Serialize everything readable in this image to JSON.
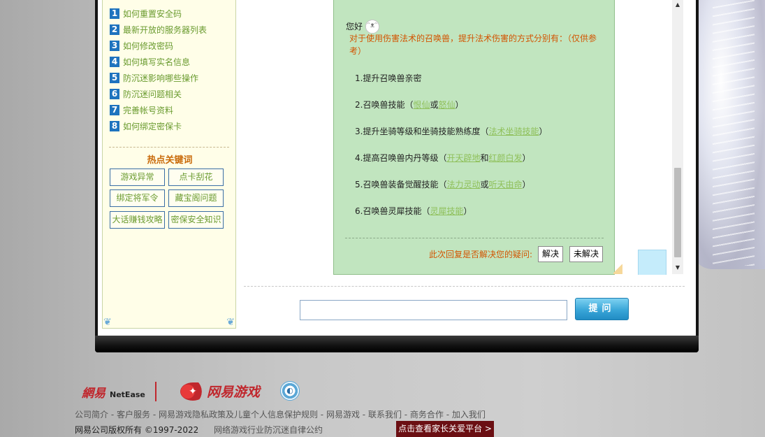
{
  "sidebar": {
    "faq": [
      {
        "num": "1",
        "label": "如何重置安全码"
      },
      {
        "num": "2",
        "label": "最新开放的服务器列表"
      },
      {
        "num": "3",
        "label": "如何修改密码"
      },
      {
        "num": "4",
        "label": "如何填写实名信息"
      },
      {
        "num": "5",
        "label": "防沉迷影响哪些操作"
      },
      {
        "num": "6",
        "label": "防沉迷问题相关"
      },
      {
        "num": "7",
        "label": "完善帐号资料"
      },
      {
        "num": "8",
        "label": "如何绑定密保卡"
      }
    ],
    "hot_title": "热点关键词",
    "keywords": [
      "游戏异常",
      "点卡刮花",
      "绑定将军令",
      "藏宝阁问题",
      "大话赚钱攻略",
      "密保安全知识"
    ]
  },
  "answer": {
    "greeting": "您好",
    "intro": "对于使用伤害法术的召唤兽，提升法术伤害的方式分别有：（仅供参考）",
    "items": [
      {
        "pre": "1.提升召唤兽亲密",
        "links": [],
        "joins": [],
        "post": ""
      },
      {
        "pre": "2.召唤兽技能（",
        "links": [
          "恨仙",
          "怒仙"
        ],
        "joins": [
          "或"
        ],
        "post": "）"
      },
      {
        "pre": "3.提升坐骑等级和坐骑技能熟练度（",
        "links": [
          "法术坐骑技能"
        ],
        "joins": [],
        "post": "）"
      },
      {
        "pre": "4.提高召唤兽内丹等级（",
        "links": [
          "开天辟地",
          "红颜白发"
        ],
        "joins": [
          "和"
        ],
        "post": "）"
      },
      {
        "pre": "5.召唤兽装备觉醒技能（",
        "links": [
          "法力灵动",
          "听天由命"
        ],
        "joins": [
          "或"
        ],
        "post": "）"
      },
      {
        "pre": "6.召唤兽灵犀技能（",
        "links": [
          "灵犀技能"
        ],
        "joins": [],
        "post": "）"
      }
    ],
    "question": "此次回复是否解决您的疑问:",
    "solved": "解决",
    "unsolved": "未解决"
  },
  "ask": {
    "input_value": "",
    "button": "提问"
  },
  "footer": {
    "netease_cn": "網易",
    "netease_en": "NetEase",
    "games_logo": "网易游戏",
    "links": [
      "公司简介",
      "客户服务",
      "网易游戏隐私政策及儿童个人信息保护规则",
      "网易游戏",
      "联系我们",
      "商务合作",
      "加入我们"
    ],
    "copyright": "网易公司版权所有 ©1997-2022",
    "self_discipline": "网络游戏行业防沉迷自律公约",
    "parent_platform": "点击查看家长关爱平台 >"
  }
}
